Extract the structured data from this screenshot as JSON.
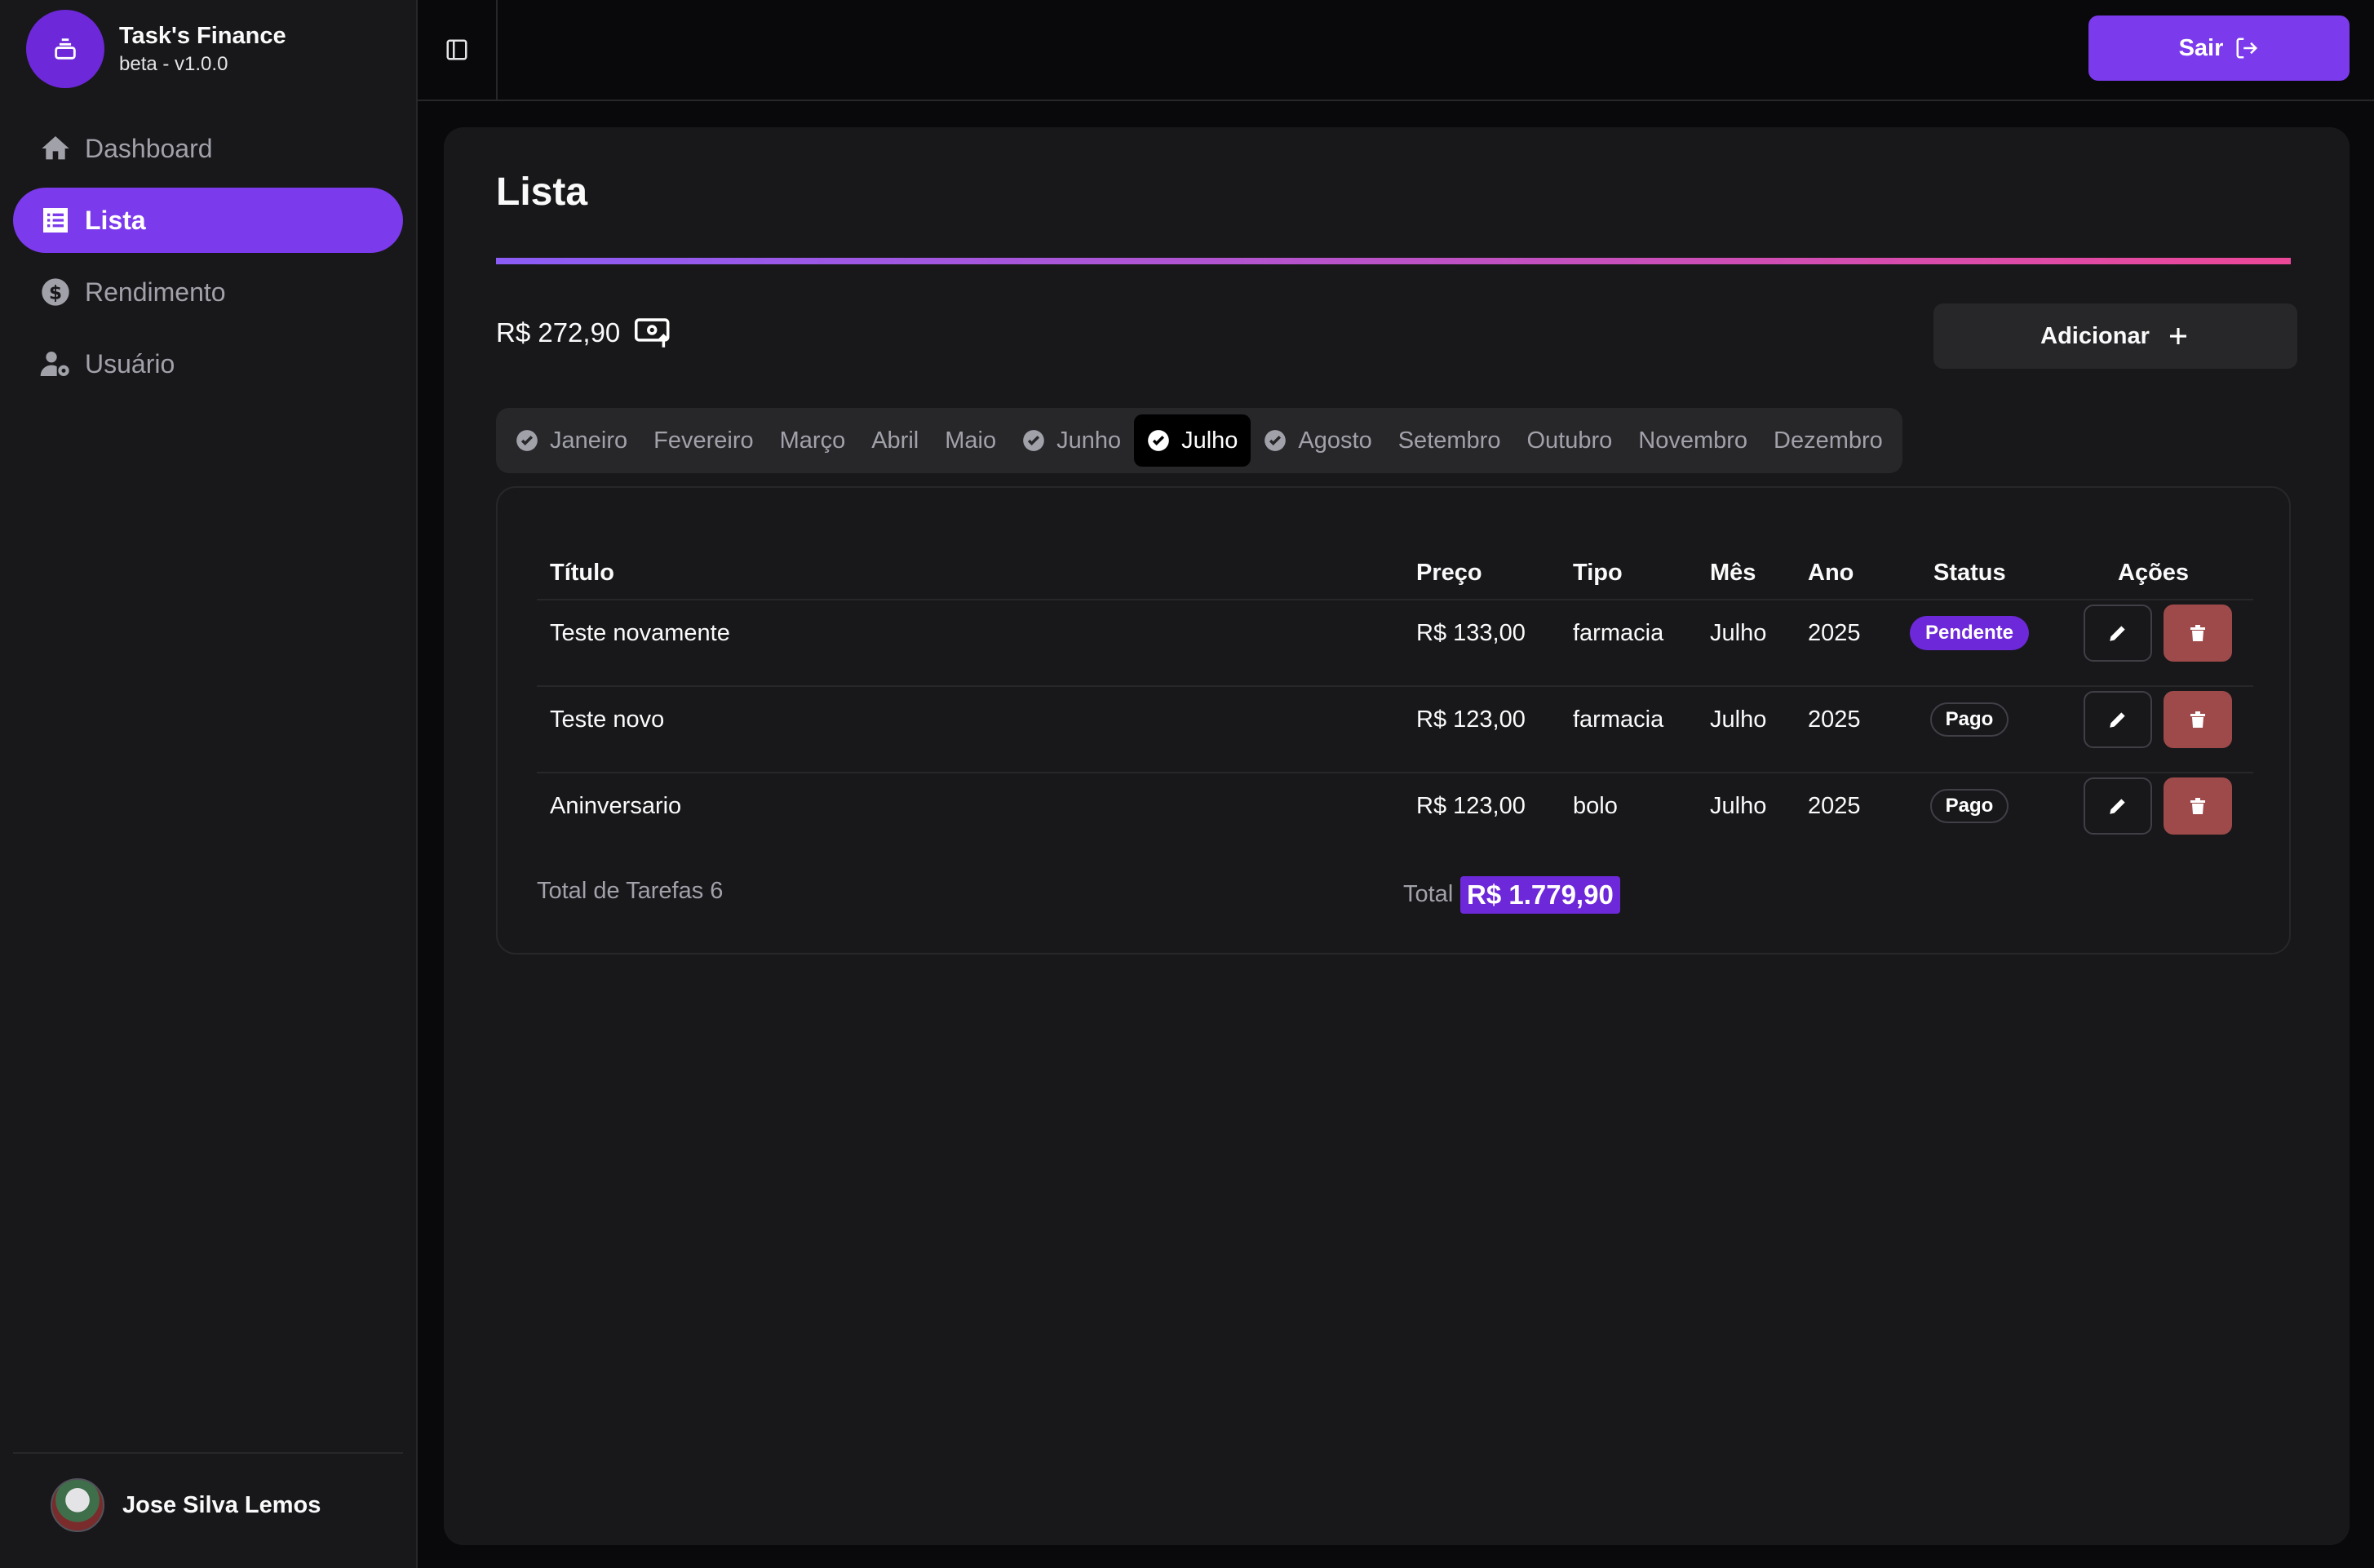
{
  "app": {
    "title": "Task's Finance",
    "version": "beta - v1.0.0"
  },
  "sidebar": {
    "items": [
      {
        "label": "Dashboard",
        "icon": "home-icon"
      },
      {
        "label": "Lista",
        "icon": "list-icon",
        "active": true
      },
      {
        "label": "Rendimento",
        "icon": "dollar-icon"
      },
      {
        "label": "Usuário",
        "icon": "user-gear-icon"
      }
    ],
    "user": {
      "name": "Jose Silva Lemos"
    }
  },
  "header": {
    "logout_label": "Sair"
  },
  "page": {
    "title": "Lista",
    "balance": "R$ 272,90",
    "add_label": "Adicionar"
  },
  "months": [
    {
      "label": "Janeiro",
      "checked": true
    },
    {
      "label": "Fevereiro",
      "checked": false
    },
    {
      "label": "Março",
      "checked": false
    },
    {
      "label": "Abril",
      "checked": false
    },
    {
      "label": "Maio",
      "checked": false
    },
    {
      "label": "Junho",
      "checked": true
    },
    {
      "label": "Julho",
      "checked": true,
      "active": true
    },
    {
      "label": "Agosto",
      "checked": true
    },
    {
      "label": "Setembro",
      "checked": false
    },
    {
      "label": "Outubro",
      "checked": false
    },
    {
      "label": "Novembro",
      "checked": false
    },
    {
      "label": "Dezembro",
      "checked": false
    }
  ],
  "table": {
    "columns": [
      "Título",
      "Preço",
      "Tipo",
      "Mês",
      "Ano",
      "Status",
      "Ações"
    ],
    "rows": [
      {
        "titulo": "Teste novamente",
        "preco": "R$ 133,00",
        "tipo": "farmacia",
        "mes": "Julho",
        "ano": "2025",
        "status": "Pendente"
      },
      {
        "titulo": "Teste novo",
        "preco": "R$ 123,00",
        "tipo": "farmacia",
        "mes": "Julho",
        "ano": "2025",
        "status": "Pago"
      },
      {
        "titulo": "Aninversario",
        "preco": "R$ 123,00",
        "tipo": "bolo",
        "mes": "Julho",
        "ano": "2025",
        "status": "Pago"
      }
    ],
    "footer": {
      "total_tasks_label": "Total de Tarefas 6",
      "total_label": "Total",
      "total_value": "R$ 1.779,90"
    }
  },
  "colors": {
    "accent": "#7c3aed",
    "delete": "#9f4a4a",
    "gradient_start": "#8b5cf6",
    "gradient_end": "#ec4899"
  }
}
